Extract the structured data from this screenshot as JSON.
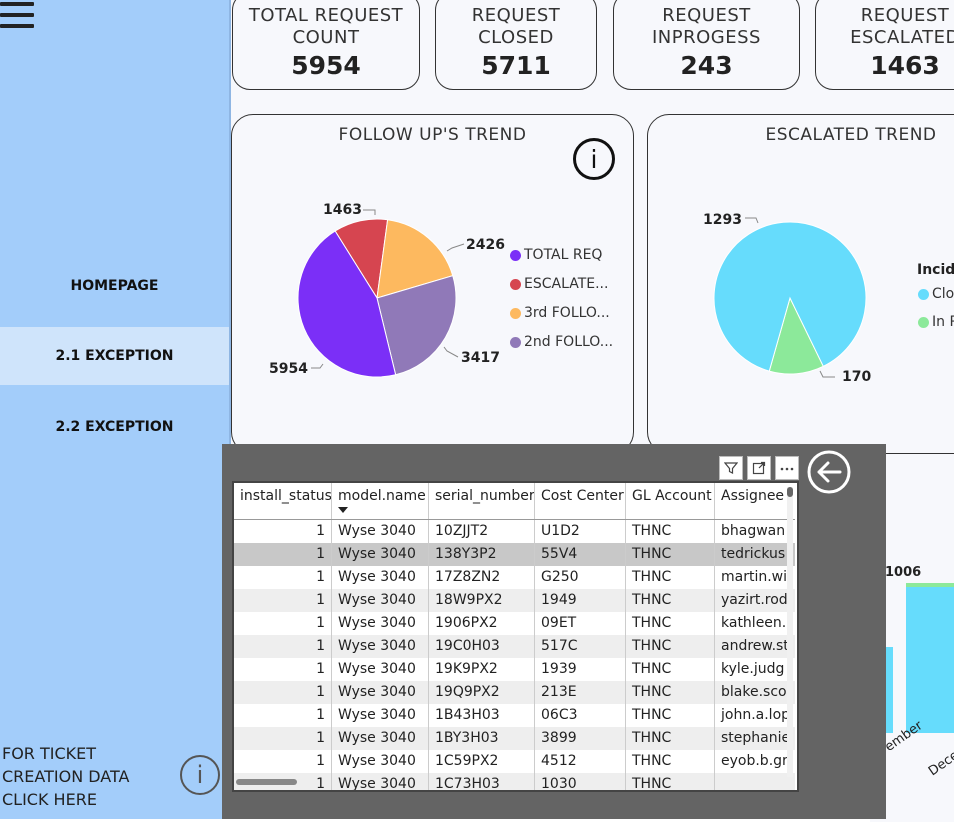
{
  "sidebar": {
    "nav": [
      {
        "label": "HOMEPAGE"
      },
      {
        "label": "2.1 EXCEPTION"
      },
      {
        "label": "2.2 EXCEPTION"
      }
    ],
    "ticket_link": [
      "FOR TICKET",
      "CREATION DATA",
      "CLICK HERE"
    ],
    "info_icon": "i"
  },
  "kpis": [
    {
      "label": "TOTAL REQUEST\nCOUNT",
      "value": "5954"
    },
    {
      "label": "REQUEST\nCLOSED",
      "value": "5711"
    },
    {
      "label": "REQUEST\nINPROGESS",
      "value": "243"
    },
    {
      "label": "REQUEST\nESCALATED",
      "value": "1463"
    }
  ],
  "followup_card": {
    "title": "FOLLOW UP'S TREND",
    "info_icon": "i"
  },
  "escalated_card": {
    "title": "ESCALATED TREND",
    "legend_title": "Incide",
    "legend": [
      "Clo",
      "In P"
    ]
  },
  "bars_card": {
    "bar_label": "1006",
    "x_labels": [
      "vember",
      "Dece"
    ]
  },
  "chart_data": [
    {
      "type": "pie",
      "title": "FOLLOW UP'S TREND",
      "categories": [
        "TOTAL REQ",
        "ESCALATE...",
        "3rd FOLLO...",
        "2nd FOLLO..."
      ],
      "values": [
        5954,
        1463,
        2426,
        3417
      ],
      "colors": [
        "#7b2ff7",
        "#d64550",
        "#fdb95f",
        "#9079b8"
      ],
      "legend": "right"
    },
    {
      "type": "pie",
      "title": "ESCALATED TREND",
      "categories": [
        "Clo",
        "In P"
      ],
      "values": [
        1293,
        170
      ],
      "colors": [
        "#66dcfc",
        "#8ce99a"
      ],
      "legend": "right"
    }
  ],
  "table": {
    "columns": [
      "install_status",
      "model.name",
      "serial_number",
      "Cost Center",
      "GL Account",
      "Assignee"
    ],
    "rows": [
      [
        "1",
        "Wyse 3040",
        "10ZJJT2",
        "U1D2",
        "THNC",
        "bhagwan"
      ],
      [
        "1",
        "Wyse 3040",
        "138Y3P2",
        "55V4",
        "THNC",
        "tedrickus"
      ],
      [
        "1",
        "Wyse 3040",
        "17Z8ZN2",
        "G250",
        "THNC",
        "martin.wi"
      ],
      [
        "1",
        "Wyse 3040",
        "18W9PX2",
        "1949",
        "THNC",
        "yazirt.rod"
      ],
      [
        "1",
        "Wyse 3040",
        "1906PX2",
        "09ET",
        "THNC",
        "kathleen."
      ],
      [
        "1",
        "Wyse 3040",
        "19C0H03",
        "517C",
        "THNC",
        "andrew.st"
      ],
      [
        "1",
        "Wyse 3040",
        "19K9PX2",
        "1939",
        "THNC",
        "kyle.judg"
      ],
      [
        "1",
        "Wyse 3040",
        "19Q9PX2",
        "213E",
        "THNC",
        "blake.sco"
      ],
      [
        "1",
        "Wyse 3040",
        "1B43H03",
        "06C3",
        "THNC",
        "john.a.lop"
      ],
      [
        "1",
        "Wyse 3040",
        "1BY3H03",
        "3899",
        "THNC",
        "stephanie"
      ],
      [
        "1",
        "Wyse 3040",
        "1C59PX2",
        "4512",
        "THNC",
        "eyob.b.gr"
      ],
      [
        "1",
        "Wyse 3040",
        "1C73H03",
        "1030",
        "THNC",
        ""
      ]
    ]
  }
}
